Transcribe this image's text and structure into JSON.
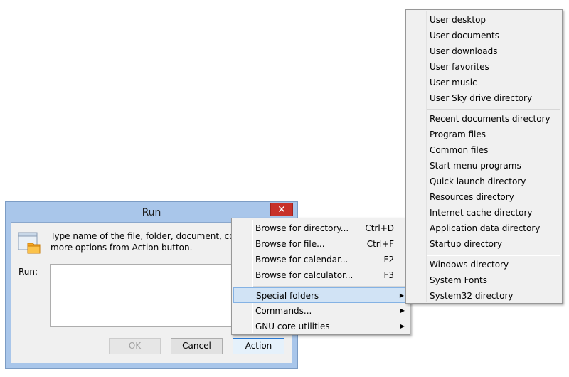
{
  "dialog": {
    "title": "Run",
    "close_glyph": "✕",
    "description": "Type name of the file, folder, document, command or more options from Action button.",
    "description_line1": "Type name of the file, folder, document, comma",
    "description_line2": "more options from Action button.",
    "run_label": "Run:",
    "run_value": "",
    "ok_label": "OK",
    "cancel_label": "Cancel",
    "action_label": "Action"
  },
  "action_menu": {
    "items": [
      {
        "label": "Browse for directory...",
        "shortcut": "Ctrl+D"
      },
      {
        "label": "Browse for file...",
        "shortcut": "Ctrl+F"
      },
      {
        "label": "Browse for calendar...",
        "shortcut": "F2"
      },
      {
        "label": "Browse for calculator...",
        "shortcut": "F3"
      },
      {
        "label": "Special folders",
        "submenu": true,
        "highlighted": true
      },
      {
        "label": "Commands...",
        "submenu": true
      },
      {
        "label": "GNU core utilities",
        "submenu": true
      }
    ]
  },
  "special_folders_menu": {
    "items": [
      "User desktop",
      "User documents",
      "User downloads",
      "User favorites",
      "User music",
      "User Sky drive directory",
      "Recent documents directory",
      "Program files",
      "Common files",
      "Start menu programs",
      "Quick launch directory",
      "Resources directory",
      "Internet cache directory",
      "Application data directory",
      "Startup directory",
      "Windows directory",
      "System Fonts",
      "System32 directory"
    ]
  },
  "colors": {
    "title_bar": "#a9c6ea",
    "close_button": "#c7312a",
    "menu_highlight": "#d1e3f5",
    "action_button_border": "#2c7ad6"
  },
  "icons": {
    "arrow": "▶"
  }
}
